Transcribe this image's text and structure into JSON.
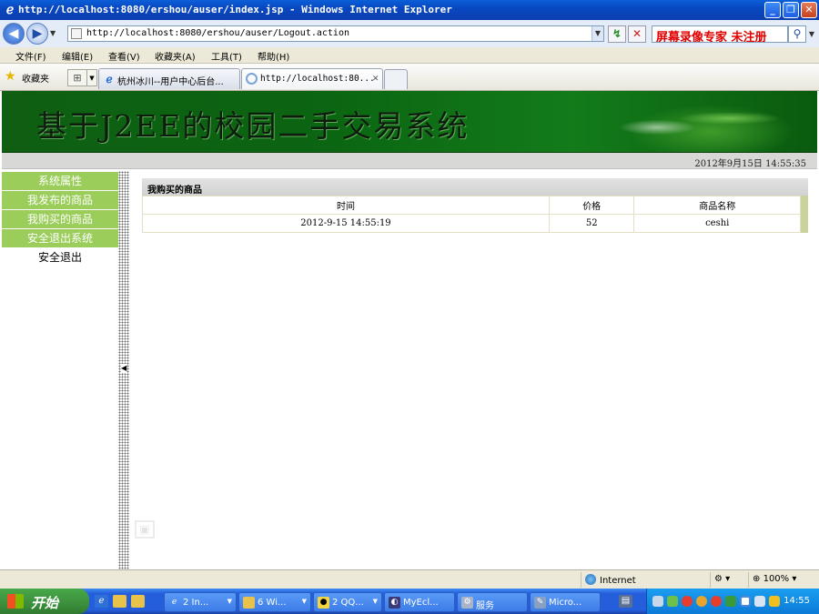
{
  "window": {
    "title": "http://localhost:8080/ershou/auser/index.jsp - Windows Internet Explorer",
    "min_label": "_",
    "max_label": "❐",
    "close_label": "✕"
  },
  "address_bar": {
    "url": "http://localhost:8080/ershou/auser/Logout.action",
    "search_text": "屏幕录像专家  未注册",
    "back_label": "◀",
    "forward_label": "▶",
    "refresh_label": "↯",
    "stop_label": "✕",
    "search_button": "⚲"
  },
  "menu": [
    {
      "label": "文件(F)"
    },
    {
      "label": "编辑(E)"
    },
    {
      "label": "查看(V)"
    },
    {
      "label": "收藏夹(A)"
    },
    {
      "label": "工具(T)"
    },
    {
      "label": "帮助(H)"
    }
  ],
  "favorites": {
    "label": "收藏夹",
    "tabs": [
      {
        "label": "杭州冰川--用户中心后台..."
      },
      {
        "label": "http://localhost:80...",
        "close": "✕"
      }
    ]
  },
  "page": {
    "banner_title": "基于J2EE的校园二手交易系统",
    "date_text": "2012年9月15日  14:55:35",
    "sidebar": [
      {
        "label": "系统属性"
      },
      {
        "label": "我发布的商品"
      },
      {
        "label": "我购买的商品"
      },
      {
        "label": "安全退出系统"
      },
      {
        "label": "安全退出"
      }
    ],
    "panel_title": "我购买的商品",
    "table": {
      "headers": [
        "时间",
        "价格",
        "商品名称"
      ],
      "rows": [
        [
          "2012-9-15 14:55:19",
          "52",
          "ceshi"
        ]
      ]
    }
  },
  "status_bar": {
    "zone": "Internet",
    "zoom": "100%"
  },
  "taskbar": {
    "start_label": "开始",
    "items": [
      {
        "label": "2 In..."
      },
      {
        "label": "6 Wi..."
      },
      {
        "label": "2 QQ..."
      },
      {
        "label": "MyEcl..."
      },
      {
        "label": "服务"
      },
      {
        "label": "Micro..."
      }
    ],
    "clock": "14:55"
  },
  "colors": {
    "sidebar_green": "#9acd5a",
    "banner_green": "#0b6512",
    "xp_blue": "#245edb"
  }
}
